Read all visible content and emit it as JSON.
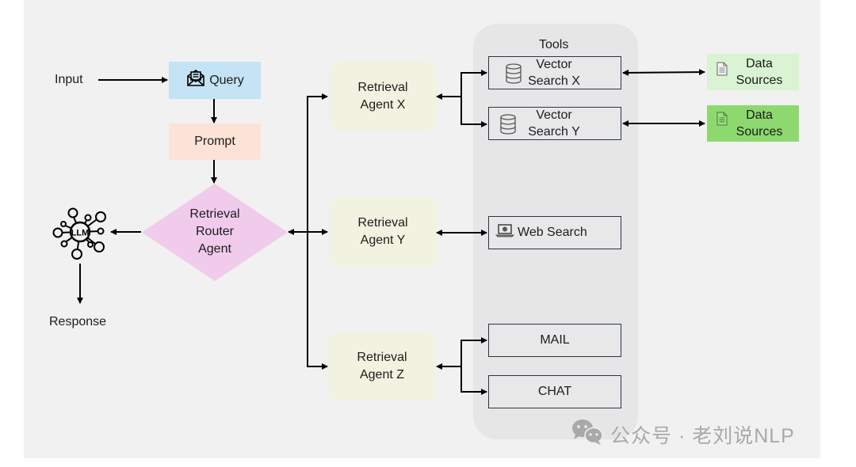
{
  "diagram": {
    "input_label": "Input",
    "query": {
      "label": "Query",
      "icon": "envelope-letter-icon",
      "color": "#c4e3f4"
    },
    "prompt": {
      "label": "Prompt",
      "color": "#fce3d6"
    },
    "router": {
      "line1": "Retrieval",
      "line2": "Router",
      "line3": "Agent",
      "color": "#f0cbec"
    },
    "llm": {
      "label": "LLM",
      "icon": "llm-network-icon"
    },
    "response_label": "Response",
    "agents": [
      {
        "line1": "Retrieval",
        "line2": "Agent X"
      },
      {
        "line1": "Retrieval",
        "line2": "Agent Y"
      },
      {
        "line1": "Retrieval",
        "line2": "Agent Z"
      }
    ],
    "tools_panel": {
      "title": "Tools",
      "items": [
        {
          "line1": "Vector",
          "line2": "Search X",
          "icon": "database-icon"
        },
        {
          "line1": "Vector",
          "line2": "Search Y",
          "icon": "database-icon"
        },
        {
          "line1": "Web Search",
          "icon": "laptop-icon"
        },
        {
          "line1": "MAIL"
        },
        {
          "line1": "CHAT"
        }
      ]
    },
    "data_sources": [
      {
        "line1": "Data",
        "line2": "Sources",
        "icon": "document-icon",
        "color": "#daf3d2"
      },
      {
        "line1": "Data",
        "line2": "Sources",
        "icon": "document-icon",
        "color": "#8dd96f"
      }
    ]
  },
  "watermark": {
    "text": "公众号 · 老刘说NLP",
    "icon": "wechat-icon"
  }
}
